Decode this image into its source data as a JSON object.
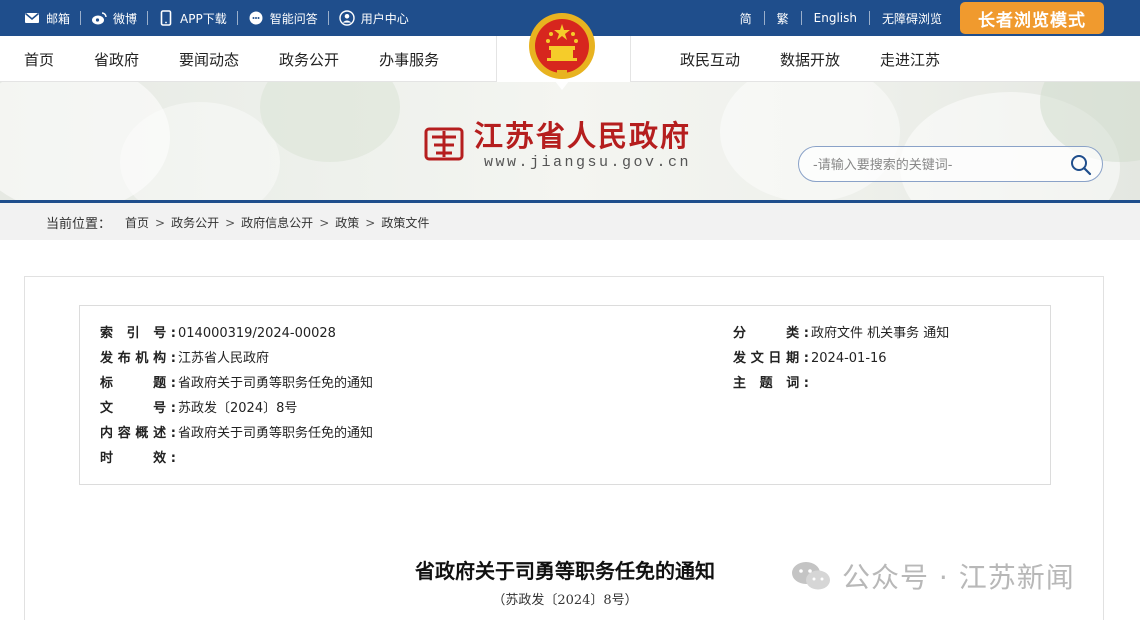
{
  "topbar": {
    "links": [
      {
        "label": "邮箱",
        "icon": "mail-icon"
      },
      {
        "label": "微博",
        "icon": "weibo-icon"
      },
      {
        "label": "APP下载",
        "icon": "phone-icon"
      },
      {
        "label": "智能问答",
        "icon": "chat-icon"
      },
      {
        "label": "用户中心",
        "icon": "user-icon"
      }
    ],
    "right_links": [
      "简",
      "繁",
      "English",
      "无障碍浏览"
    ],
    "elder_mode": "长者浏览模式"
  },
  "nav": {
    "left": [
      "首页",
      "省政府",
      "要闻动态",
      "政务公开",
      "办事服务"
    ],
    "right": [
      "政民互动",
      "数据开放",
      "走进江苏"
    ]
  },
  "site": {
    "title": "江苏省人民政府",
    "url": "www.jiangsu.gov.cn"
  },
  "search": {
    "placeholder": "-请输入要搜索的关键词-"
  },
  "breadcrumb": {
    "label": "当前位置：",
    "items": [
      "首页",
      "政务公开",
      "政府信息公开",
      "政策",
      "政策文件"
    ]
  },
  "meta": {
    "index_key": "索 引 号:",
    "index_val": "014000319/2024-00028",
    "org_key": "发布机构:",
    "org_val": "江苏省人民政府",
    "title_key": "标　　题:",
    "title_val": "省政府关于司勇等职务任免的通知",
    "docno_key": "文　　号:",
    "docno_val": "苏政发〔2024〕8号",
    "summary_key": "内容概述:",
    "summary_val": "省政府关于司勇等职务任免的通知",
    "validity_key": "时　　效:",
    "validity_val": "",
    "category_key": "分　　类:",
    "category_val": "政府文件 机关事务 通知",
    "date_key": "发文日期:",
    "date_val": "2024-01-16",
    "subject_key": "主 题 词:",
    "subject_val": ""
  },
  "document": {
    "title": "省政府关于司勇等职务任免的通知",
    "number": "（苏政发〔2024〕8号）"
  },
  "watermark": "公众号 · 江苏新闻",
  "colors": {
    "topbar": "#1f4e8c",
    "elder_button": "#f09a2e",
    "site_title": "#b51e1e"
  }
}
